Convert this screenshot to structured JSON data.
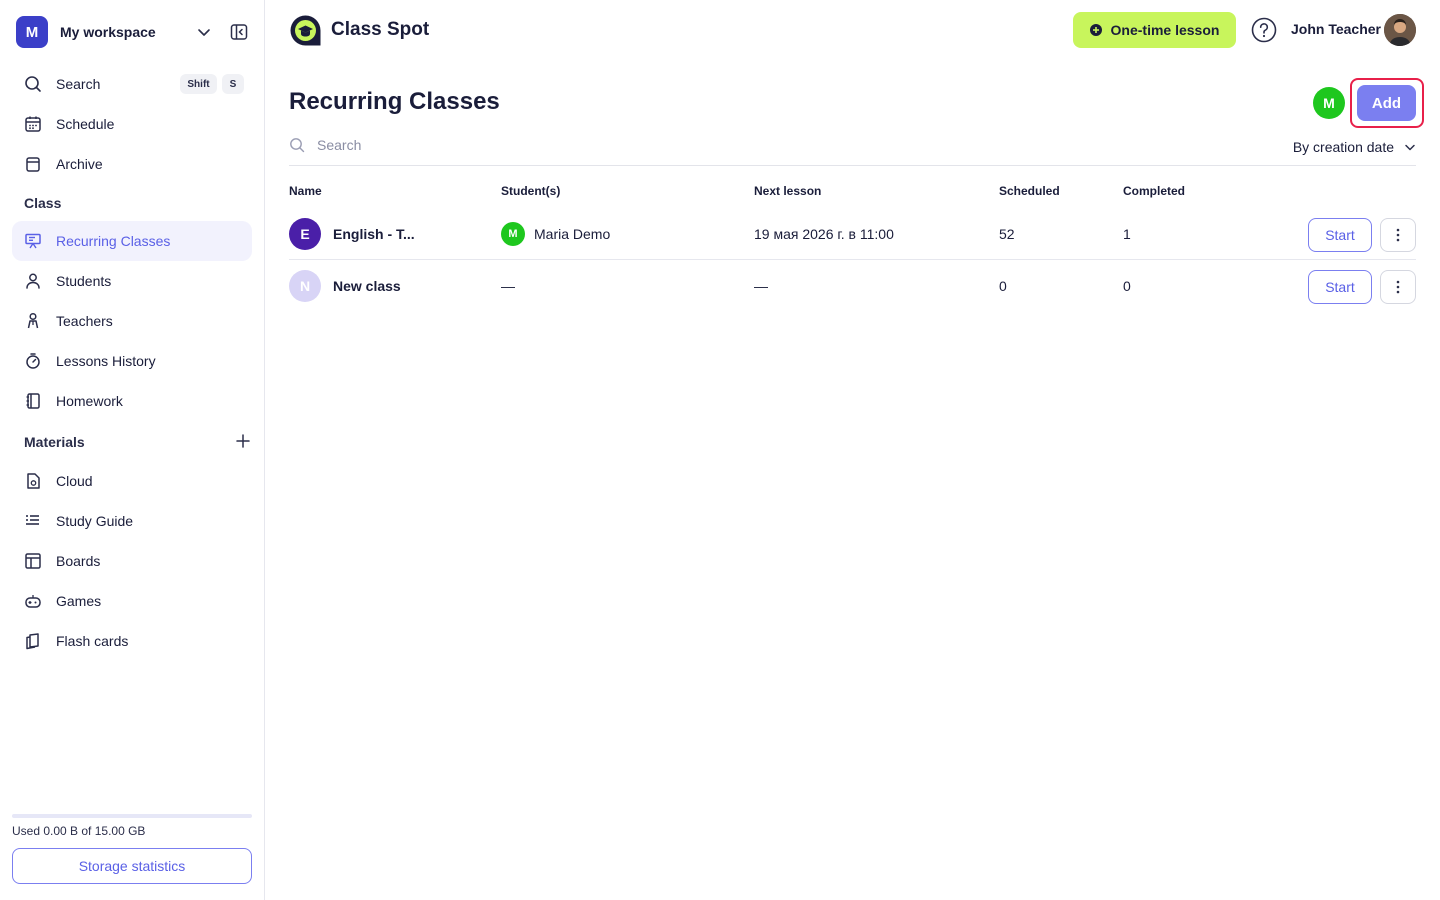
{
  "workspace": {
    "avatar_letter": "M",
    "name": "My workspace"
  },
  "sidebar": {
    "search": {
      "label": "Search",
      "kbd1": "Shift",
      "kbd2": "S"
    },
    "top_items": [
      {
        "label": "Schedule",
        "icon": "calendar-icon"
      },
      {
        "label": "Archive",
        "icon": "archive-icon"
      }
    ],
    "class_section": "Class",
    "class_items": [
      {
        "label": "Recurring Classes",
        "icon": "presentation-icon",
        "active": true
      },
      {
        "label": "Students",
        "icon": "user-icon"
      },
      {
        "label": "Teachers",
        "icon": "teacher-icon"
      },
      {
        "label": "Lessons History",
        "icon": "stopwatch-icon"
      },
      {
        "label": "Homework",
        "icon": "notebook-icon"
      }
    ],
    "materials_section": "Materials",
    "material_items": [
      {
        "label": "Cloud",
        "icon": "file-icon"
      },
      {
        "label": "Study Guide",
        "icon": "list-icon"
      },
      {
        "label": "Boards",
        "icon": "board-icon"
      },
      {
        "label": "Games",
        "icon": "gamepad-icon"
      },
      {
        "label": "Flash cards",
        "icon": "cards-icon"
      }
    ],
    "storage_text": "Used 0.00 B of 15.00 GB",
    "storage_fraction": 0,
    "storage_button": "Storage statistics"
  },
  "header": {
    "brand": "Class Spot",
    "one_time_lesson": "One-time lesson",
    "user_name": "John Teacher"
  },
  "main": {
    "title": "Recurring Classes",
    "member_avatar_letter": "M",
    "add_label": "Add",
    "search_placeholder": "Search",
    "sort_label": "By creation date",
    "columns": {
      "name": "Name",
      "students": "Student(s)",
      "next_lesson": "Next lesson",
      "scheduled": "Scheduled",
      "completed": "Completed"
    },
    "rows": [
      {
        "avatar_letter": "E",
        "avatar_color": "#4a1fa8",
        "name": "English - T...",
        "student_avatar": "M",
        "student": "Maria Demo",
        "next_lesson": "19 мая 2026 г. в 11:00",
        "scheduled": "52",
        "completed": "1",
        "start_label": "Start"
      },
      {
        "avatar_letter": "N",
        "avatar_color": "#d8d4f6",
        "name": "New class",
        "student": "—",
        "next_lesson": "—",
        "scheduled": "0",
        "completed": "0",
        "start_label": "Start"
      }
    ]
  },
  "colors": {
    "accent": "#7b7ff0",
    "accent_text": "#5a60e6",
    "lime": "#c8f55c",
    "green": "#1ec71e",
    "highlight": "#e8204a"
  }
}
